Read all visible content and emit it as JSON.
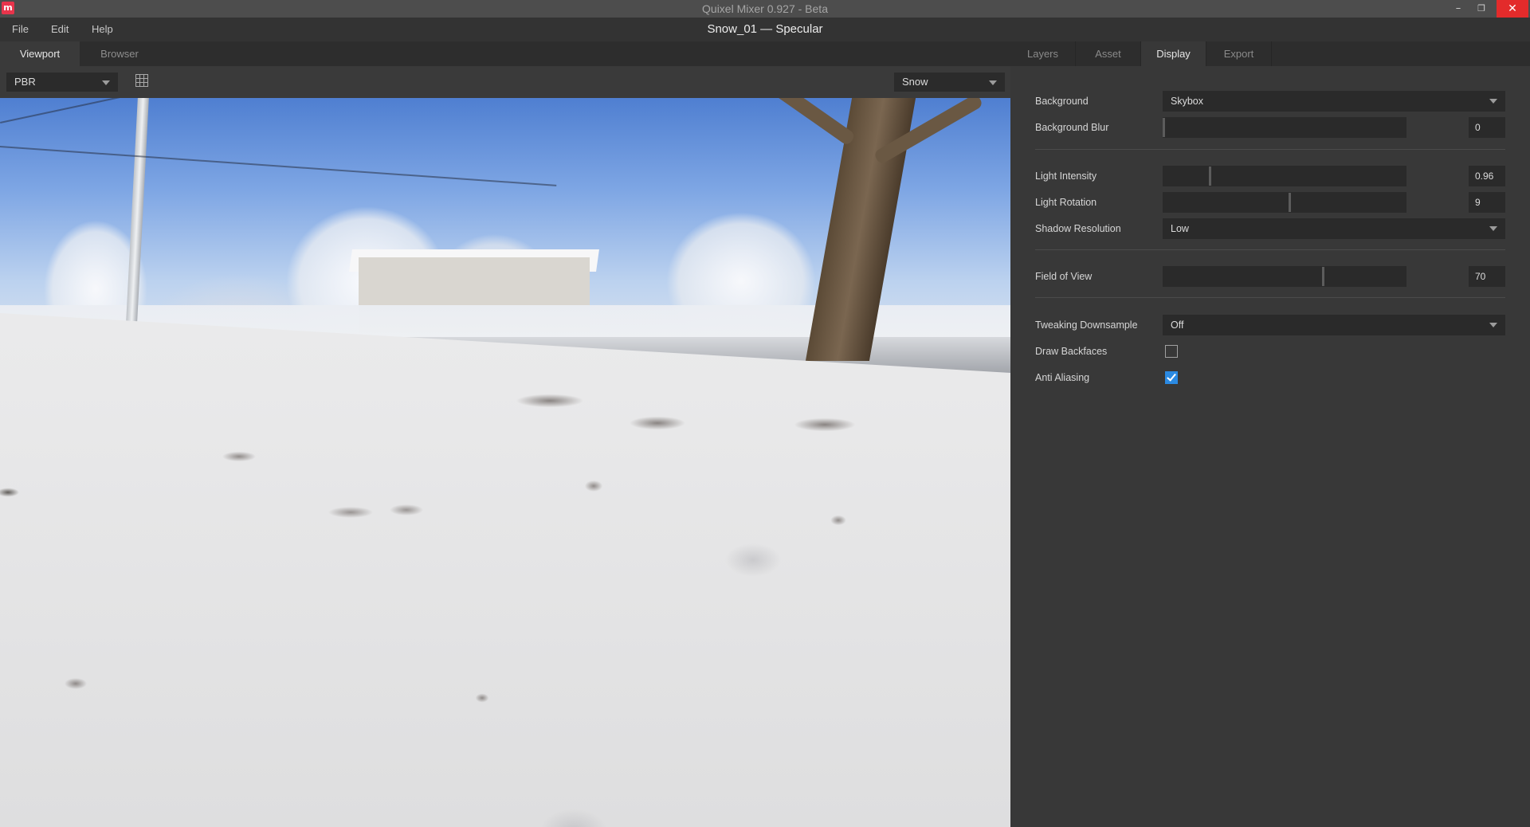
{
  "window": {
    "app_title": "Quixel Mixer 0.927 - Beta",
    "logo_letter": "m",
    "minimize": "–",
    "maximize": "❐",
    "close": "✕"
  },
  "menu": {
    "items": [
      "File",
      "Edit",
      "Help"
    ],
    "document_title": "Snow_01 — Specular"
  },
  "left_tabs": [
    {
      "label": "Viewport",
      "active": true
    },
    {
      "label": "Browser",
      "active": false
    }
  ],
  "viewport_toolbar": {
    "render_mode": "PBR",
    "grid_icon": "grid-icon",
    "material": "Snow"
  },
  "right_tabs": [
    {
      "label": "Layers",
      "active": false
    },
    {
      "label": "Asset",
      "active": false
    },
    {
      "label": "Display",
      "active": true
    },
    {
      "label": "Export",
      "active": false
    }
  ],
  "display": {
    "background": {
      "label": "Background",
      "value": "Skybox"
    },
    "background_blur": {
      "label": "Background Blur",
      "value": "0",
      "fraction": 0.0
    },
    "light_intensity": {
      "label": "Light Intensity",
      "value": "0.96",
      "fraction": 0.19
    },
    "light_rotation": {
      "label": "Light Rotation",
      "value": "9",
      "fraction": 0.52
    },
    "shadow_resolution": {
      "label": "Shadow Resolution",
      "value": "Low"
    },
    "field_of_view": {
      "label": "Field of View",
      "value": "70",
      "fraction": 0.66
    },
    "tweaking_downsample": {
      "label": "Tweaking Downsample",
      "value": "Off"
    },
    "draw_backfaces": {
      "label": "Draw Backfaces",
      "checked": false
    },
    "anti_aliasing": {
      "label": "Anti Aliasing",
      "checked": true
    }
  },
  "colors": {
    "accent": "#2b8ae2",
    "close_button": "#e32b2b",
    "panel_bg": "#383838",
    "field_bg": "#2a2a2a"
  }
}
